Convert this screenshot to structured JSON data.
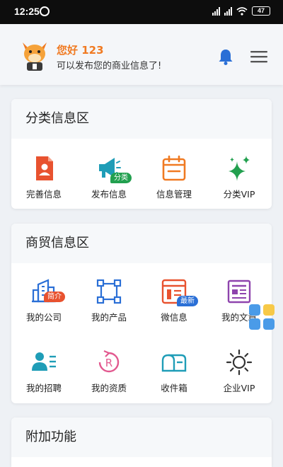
{
  "status": {
    "time": "12:25",
    "battery": "47"
  },
  "header": {
    "greeting": "您好 123",
    "subtitle": "可以发布您的商业信息了!"
  },
  "section1": {
    "title": "分类信息区",
    "items": [
      {
        "label": "完善信息",
        "icon": "profile-document-icon"
      },
      {
        "label": "发布信息",
        "icon": "megaphone-icon",
        "tag": "分类"
      },
      {
        "label": "信息管理",
        "icon": "calendar-manage-icon"
      },
      {
        "label": "分类VIP",
        "icon": "sparkle-icon"
      }
    ]
  },
  "section2": {
    "title": "商贸信息区",
    "items": [
      {
        "label": "我的公司",
        "icon": "building-icon",
        "tag": "简介"
      },
      {
        "label": "我的产品",
        "icon": "product-frame-icon"
      },
      {
        "label": "微信息",
        "icon": "micro-info-icon",
        "tag": "最新"
      },
      {
        "label": "我的文章",
        "icon": "newspaper-icon"
      },
      {
        "label": "我的招聘",
        "icon": "recruit-people-icon"
      },
      {
        "label": "我的资质",
        "icon": "registered-certificate-icon"
      },
      {
        "label": "收件箱",
        "icon": "mailbox-icon"
      },
      {
        "label": "企业VIP",
        "icon": "sun-icon"
      }
    ]
  },
  "section3": {
    "title": "附加功能"
  },
  "colors": {
    "accent": "#f07a22",
    "blue": "#2a6fd6",
    "green": "#22a04f",
    "red": "#e8522f"
  }
}
